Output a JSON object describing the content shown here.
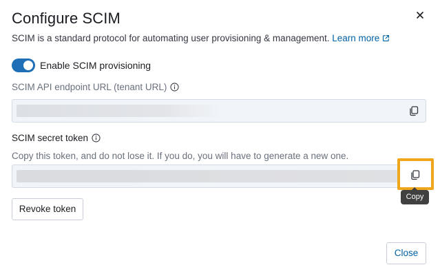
{
  "dialog": {
    "title": "Configure SCIM",
    "description": "SCIM is a standard protocol for automating user provisioning & management.",
    "learn_more_label": "Learn more"
  },
  "toggle": {
    "label": "Enable SCIM provisioning",
    "enabled": true
  },
  "endpoint": {
    "label": "SCIM API endpoint URL (tenant URL)",
    "value": ""
  },
  "token": {
    "label": "SCIM secret token",
    "hint": "Copy this token, and do not lose it. If you do, you will have to generate a new one.",
    "value": ""
  },
  "tooltip": {
    "text": "Copy"
  },
  "buttons": {
    "revoke_label": "Revoke token",
    "close_label": "Close"
  },
  "colors": {
    "accent": "#1f6fb7",
    "link": "#0061a6",
    "highlight": "#f0a61c"
  },
  "icons": [
    "close-icon",
    "external-link-icon",
    "info-icon",
    "copy-icon"
  ]
}
